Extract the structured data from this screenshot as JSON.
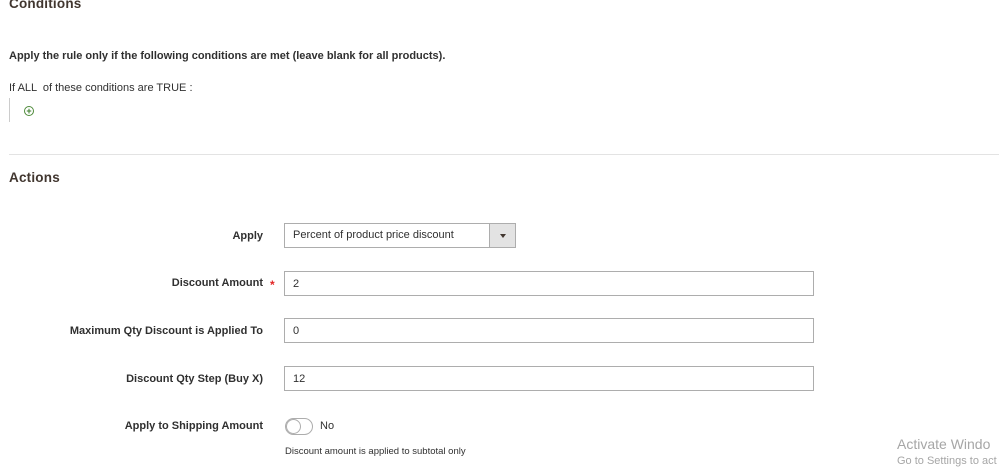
{
  "conditions": {
    "title": "Conditions",
    "description": "Apply the rule only if the following conditions are met (leave blank for all products).",
    "rule": {
      "prefix": "If",
      "aggregator": "ALL",
      "middle": "of these conditions are",
      "value": "TRUE",
      "suffix": ":"
    },
    "add_icon": "plus-circle-icon",
    "add_symbol": "+"
  },
  "actions": {
    "title": "Actions",
    "apply": {
      "label": "Apply",
      "value": "Percent of product price discount"
    },
    "discount_amount": {
      "label": "Discount Amount",
      "required_mark": "*",
      "value": "2"
    },
    "max_qty": {
      "label": "Maximum Qty Discount is Applied To",
      "value": "0"
    },
    "qty_step": {
      "label": "Discount Qty Step (Buy X)",
      "value": "12"
    },
    "apply_shipping": {
      "label": "Apply to Shipping Amount",
      "state": "No",
      "note": "Discount amount is applied to subtotal only"
    }
  },
  "watermark": {
    "title": "Activate Windo",
    "subtitle": "Go to Settings to act"
  },
  "colors": {
    "required": "#e22626",
    "add_icon": "#4e8a3a",
    "border": "#adadad"
  }
}
